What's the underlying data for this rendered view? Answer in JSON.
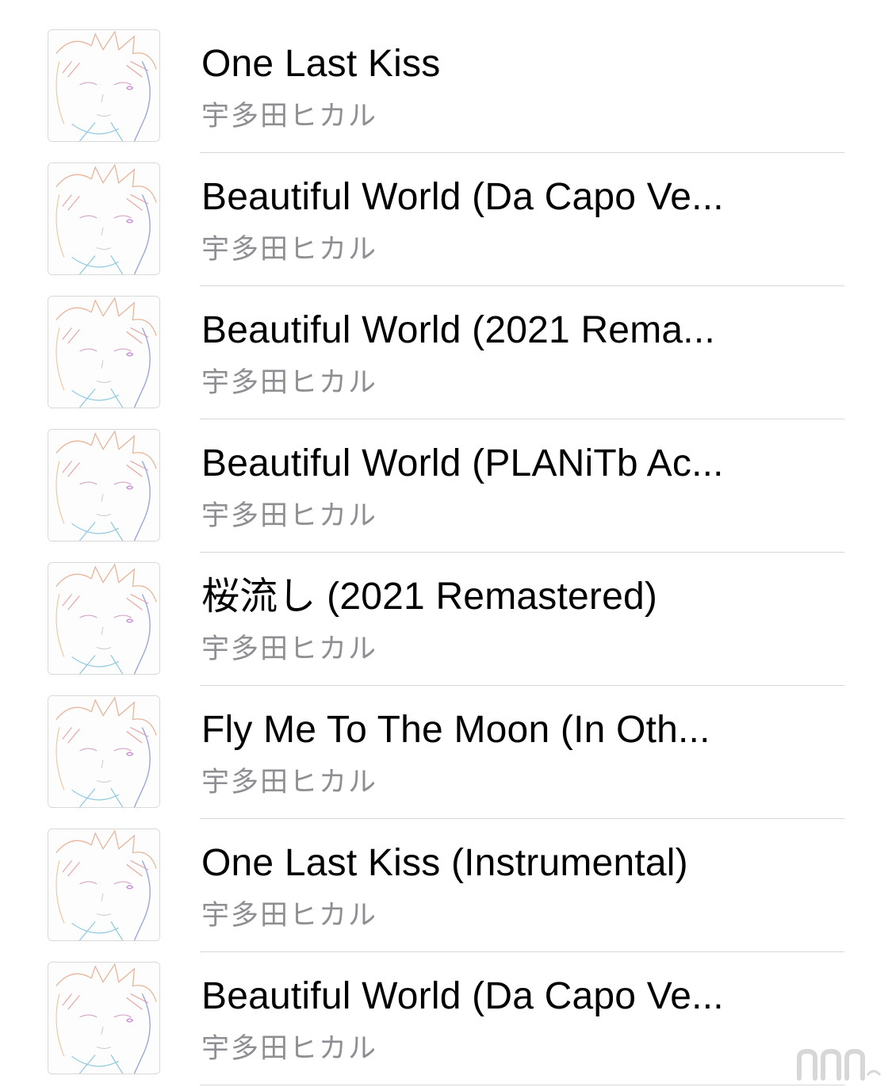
{
  "songs": [
    {
      "title": "One Last Kiss",
      "artist": "宇多田ヒカル"
    },
    {
      "title": "Beautiful World (Da Capo Ve...",
      "artist": "宇多田ヒカル"
    },
    {
      "title": "Beautiful World (2021 Rema...",
      "artist": "宇多田ヒカル"
    },
    {
      "title": "Beautiful World (PLANiTb Ac...",
      "artist": "宇多田ヒカル"
    },
    {
      "title": "桜流し (2021 Remastered)",
      "artist": "宇多田ヒカル"
    },
    {
      "title": "Fly Me To The Moon (In Oth...",
      "artist": "宇多田ヒカル"
    },
    {
      "title": "One Last Kiss (Instrumental)",
      "artist": "宇多田ヒカル"
    },
    {
      "title": "Beautiful World (Da Capo Ve...",
      "artist": "宇多田ヒカル"
    }
  ],
  "album_art_icon": "line-sketch-portrait-icon",
  "watermark": {
    "icon": "site-logo-watermark-icon",
    "text": "nnn"
  },
  "colors": {
    "title": "#000000",
    "subtitle": "#8e8e93",
    "separator": "#d6d6d8",
    "background": "#ffffff"
  }
}
